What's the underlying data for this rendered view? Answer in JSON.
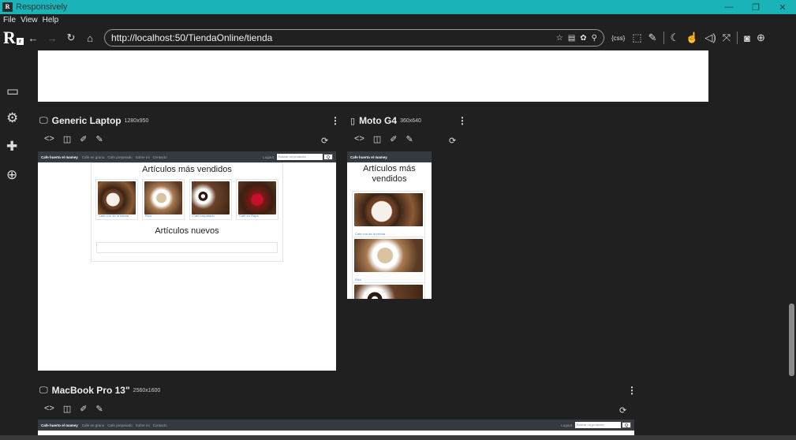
{
  "window": {
    "title": "Responsively",
    "app_icon": "R",
    "minimize": "—",
    "maximize": "❐",
    "close": "✕"
  },
  "menu": [
    "File",
    "View",
    "Help"
  ],
  "toolbar": {
    "logo_main": "R",
    "logo_sub": "r",
    "url": "http://localhost:50/TiendaOnline/tienda",
    "css_label": "{css}"
  },
  "sidebar": {
    "icons": [
      "devices-icon",
      "settings-icon",
      "extensions-icon",
      "network-icon"
    ]
  },
  "devices": {
    "laptop": {
      "name": "Generic Laptop",
      "res": "1280x950"
    },
    "moto": {
      "name": "Moto G4",
      "res": "360x640"
    },
    "macbook": {
      "name": "MacBook Pro 13\"",
      "res": "2560x1600"
    },
    "kebab": "⋮"
  },
  "site": {
    "brand": "Cafe huerto el mamey",
    "links": [
      "Cafe en grano",
      "Cafe preparado",
      "Sobre mi",
      "Contacto"
    ],
    "logout": "Logout",
    "search_placeholder": "Buscar un producto",
    "search_btn": "Q",
    "heading_best": "Artículos más vendidos",
    "heading_new": "Artículos nuevos",
    "products": [
      "Cafe con de la crema",
      "Rico",
      "Cafe preparado",
      "Cafe en Rapa"
    ],
    "moto_products": [
      "Cafe con de la crema",
      "Rico"
    ]
  },
  "colors": {
    "accent": "#1ab4b8",
    "site_nav": "#343a40",
    "link": "#3b8fd3"
  }
}
